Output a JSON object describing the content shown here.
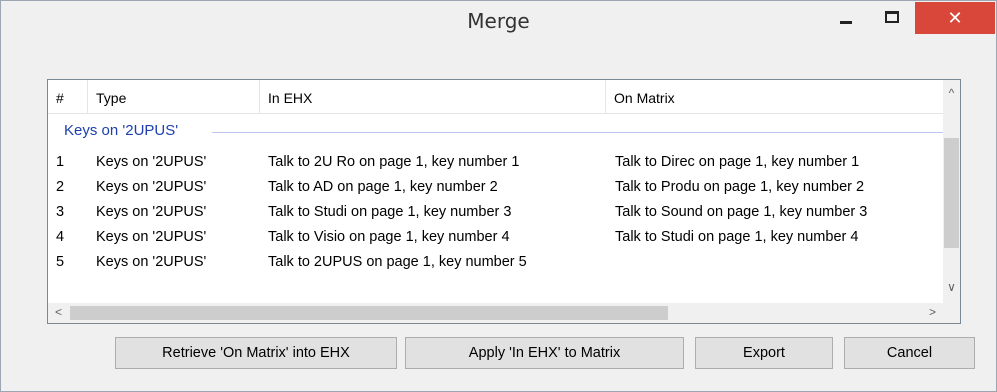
{
  "window": {
    "title": "Merge"
  },
  "titlebar": {
    "minimize_icon": "minimize-icon",
    "maximize_icon": "maximize-icon",
    "close_icon": "close-icon",
    "close_glyph": "✕",
    "close_color": "#d9473b"
  },
  "table": {
    "columns": [
      "#",
      "Type",
      "In EHX",
      "On Matrix"
    ],
    "group": "Keys on '2UPUS'",
    "rows": [
      {
        "num": "1",
        "type": "Keys on '2UPUS'",
        "ehx": "Talk to 2U Ro on page 1, key number 1",
        "matrix": "Talk to Direc on page 1, key number 1"
      },
      {
        "num": "2",
        "type": "Keys on '2UPUS'",
        "ehx": "Talk to AD on page 1, key number 2",
        "matrix": "Talk to Produ on page 1, key number 2"
      },
      {
        "num": "3",
        "type": "Keys on '2UPUS'",
        "ehx": "Talk to Studi on page 1, key number 3",
        "matrix": "Talk to Sound on page 1, key number 3"
      },
      {
        "num": "4",
        "type": "Keys on '2UPUS'",
        "ehx": "Talk to Visio on page 1, key number 4",
        "matrix": "Talk to Studi on page 1, key number 4"
      },
      {
        "num": "5",
        "type": "Keys on '2UPUS'",
        "ehx": "Talk to 2UPUS on page 1, key number 5",
        "matrix": ""
      }
    ]
  },
  "scroll": {
    "up": "^",
    "down": "∨",
    "left": "<",
    "right": ">"
  },
  "buttons": {
    "retrieve": "Retrieve 'On Matrix' into EHX",
    "apply": "Apply 'In EHX' to Matrix",
    "export": "Export",
    "cancel": "Cancel"
  }
}
